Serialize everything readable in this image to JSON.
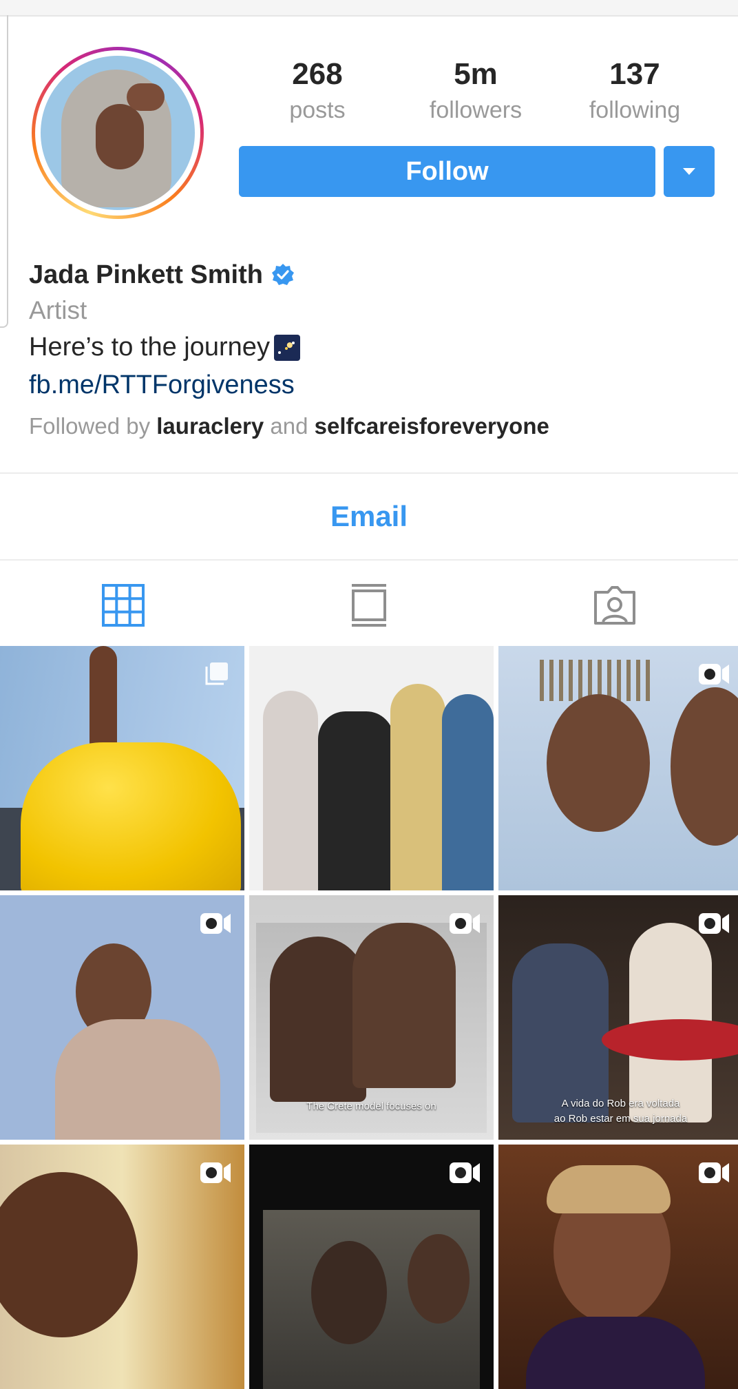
{
  "profile": {
    "stats": [
      {
        "value": "268",
        "label": "posts"
      },
      {
        "value": "5m",
        "label": "followers"
      },
      {
        "value": "137",
        "label": "following"
      }
    ],
    "follow_label": "Follow",
    "name": "Jada Pinkett Smith",
    "category": "Artist",
    "bio": "Here’s to the journey",
    "link": "fb.me/RTTForgiveness",
    "followed_by": {
      "prefix": "Followed by",
      "user1": "lauraclery",
      "connector": "and",
      "user2": "selfcareisforeveryone"
    },
    "email_label": "Email"
  },
  "tabs": [
    {
      "icon": "grid-icon",
      "active": true
    },
    {
      "icon": "feed-icon",
      "active": false
    },
    {
      "icon": "tagged-icon",
      "active": false
    }
  ],
  "posts": [
    {
      "indicator": "carousel-icon",
      "caption": ""
    },
    {
      "indicator": "",
      "caption": ""
    },
    {
      "indicator": "video-icon",
      "caption": ""
    },
    {
      "indicator": "video-icon",
      "caption": ""
    },
    {
      "indicator": "video-icon",
      "caption": "The Crete model focuses on"
    },
    {
      "indicator": "video-icon",
      "caption_line1": "A vida do Rob era voltada",
      "caption_line2": "ao Rob estar em sua jornada"
    },
    {
      "indicator": "video-icon",
      "caption": ""
    },
    {
      "indicator": "video-icon",
      "caption": ""
    },
    {
      "indicator": "video-icon",
      "caption": ""
    }
  ],
  "colors": {
    "accent": "#3897f0",
    "text": "#262626",
    "muted": "#999999",
    "link": "#003569"
  }
}
